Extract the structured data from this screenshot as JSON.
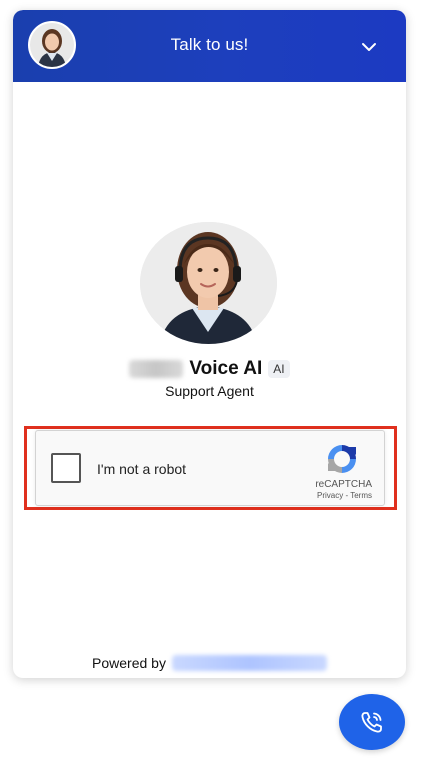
{
  "header": {
    "title": "Talk to us!",
    "avatar_icon": "agent-avatar",
    "collapse_icon": "chevron-down-icon"
  },
  "agent": {
    "name": "Voice AI",
    "badge": "AI",
    "role": "Support Agent"
  },
  "recaptcha": {
    "label": "I'm not a robot",
    "brand": "reCAPTCHA",
    "privacy": "Privacy",
    "separator": "-",
    "terms": "Terms"
  },
  "footer": {
    "powered_by": "Powered by"
  },
  "call_button": {
    "icon": "phone-call-icon"
  },
  "colors": {
    "header_bg": "#1d3fbd",
    "accent": "#1f63e8",
    "highlight": "#e0301e"
  }
}
